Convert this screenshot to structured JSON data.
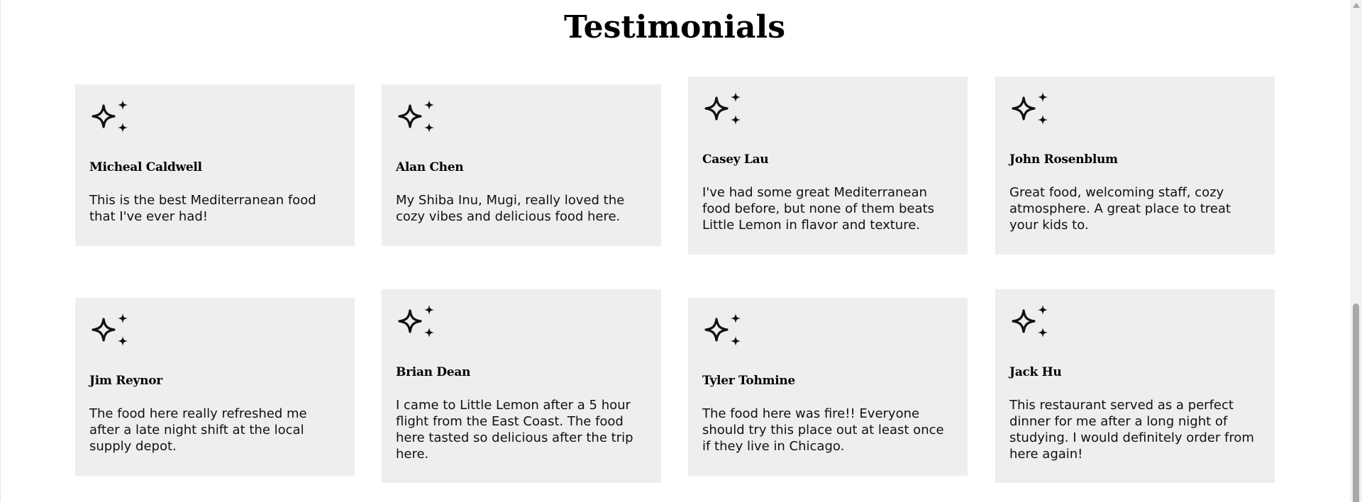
{
  "section": {
    "title": "Testimonials"
  },
  "testimonials": [
    {
      "icon": "sparkles-icon",
      "name": "Micheal Caldwell",
      "quote": "This is the best Mediterranean food that I've ever had!"
    },
    {
      "icon": "sparkles-icon",
      "name": "Alan Chen",
      "quote": "My Shiba Inu, Mugi, really loved the cozy vibes and delicious food here."
    },
    {
      "icon": "sparkles-icon",
      "name": "Casey Lau",
      "quote": "I've had some great Mediterranean food before, but none of them beats Little Lemon in flavor and texture."
    },
    {
      "icon": "sparkles-icon",
      "name": "John Rosenblum",
      "quote": "Great food, welcoming staff, cozy atmosphere. A great place to treat your kids to."
    },
    {
      "icon": "sparkles-icon",
      "name": "Jim Reynor",
      "quote": "The food here really refreshed me after a late night shift at the local supply depot."
    },
    {
      "icon": "sparkles-icon",
      "name": "Brian Dean",
      "quote": "I came to Little Lemon after a 5 hour flight from the East Coast. The food here tasted so delicious after the trip here."
    },
    {
      "icon": "sparkles-icon",
      "name": "Tyler Tohmine",
      "quote": "The food here was fire!! Everyone should try this place out at least once if they live in Chicago."
    },
    {
      "icon": "sparkles-icon",
      "name": "Jack Hu",
      "quote": "This restaurant served as a perfect dinner for me after a long night of studying. I would definitely order from here again!"
    }
  ],
  "colors": {
    "card_background": "#edeeed",
    "text": "#000000"
  }
}
